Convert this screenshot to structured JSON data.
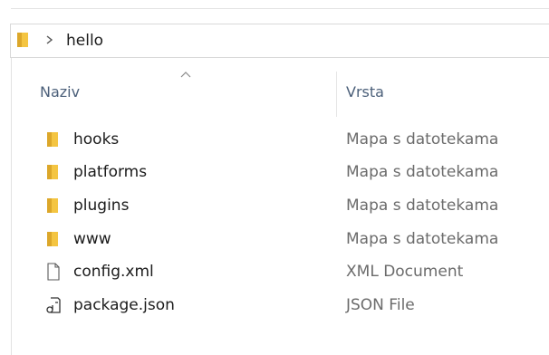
{
  "breadcrumb": {
    "items": [
      "hello"
    ]
  },
  "columns": {
    "name_label": "Naziv",
    "type_label": "Vrsta",
    "sort_direction": "ascending"
  },
  "files": [
    {
      "name": "hooks",
      "type": "Mapa s datotekama",
      "icon": "folder-icon"
    },
    {
      "name": "platforms",
      "type": "Mapa s datotekama",
      "icon": "folder-icon"
    },
    {
      "name": "plugins",
      "type": "Mapa s datotekama",
      "icon": "folder-icon"
    },
    {
      "name": "www",
      "type": "Mapa s datotekama",
      "icon": "folder-icon"
    },
    {
      "name": "config.xml",
      "type": "XML Document",
      "icon": "document-icon"
    },
    {
      "name": "package.json",
      "type": "JSON File",
      "icon": "json-file-icon"
    }
  ],
  "colors": {
    "folder": "#f4c542",
    "folder_dark": "#dca72a",
    "header_text": "#4c607a",
    "secondary_text": "#6b6b6b"
  }
}
